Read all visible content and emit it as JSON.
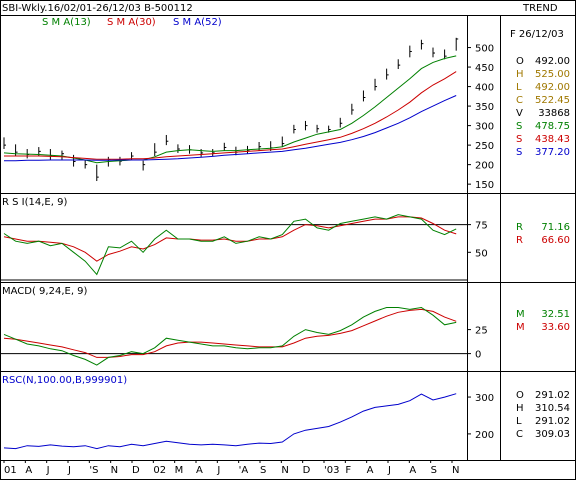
{
  "header": {
    "title": "SBI-Wkly.16/02/01-26/12/03  B-500112",
    "trend_label": "TREND",
    "date_label": "F 26/12/03"
  },
  "colors": {
    "price": "#000000",
    "sma13": "#008000",
    "sma30": "#cc0000",
    "sma52": "#0000cc",
    "rsc": "#0000cc",
    "reference": "#000000"
  },
  "x_axis": {
    "labels": [
      "01",
      "A",
      "J",
      "J",
      "'S",
      "N",
      "D",
      "02",
      "M",
      "A",
      "J",
      "'A",
      "S",
      "N",
      "D",
      "'03",
      "F",
      "A",
      "J",
      "A",
      "S",
      "N"
    ]
  },
  "chart_data": [
    {
      "type": "bar",
      "name": "price",
      "legend": [
        "S M A(13)",
        "S M A(30)",
        "S M A(52)"
      ],
      "yticks": [
        150,
        200,
        250,
        300,
        350,
        400,
        450,
        500
      ],
      "ylim": [
        135,
        545
      ],
      "x": [
        0,
        4,
        8,
        12,
        16,
        20,
        24,
        28,
        32,
        36,
        40,
        44,
        48,
        52,
        56,
        60,
        64,
        68,
        72,
        76,
        80,
        84,
        88,
        92,
        96,
        100,
        104,
        108,
        112,
        116,
        120,
        124,
        128,
        132,
        136,
        140,
        144,
        148,
        152,
        156
      ],
      "close": [
        250,
        232,
        226,
        234,
        222,
        228,
        208,
        200,
        168,
        212,
        209,
        222,
        200,
        232,
        260,
        240,
        238,
        230,
        230,
        244,
        232,
        237,
        246,
        243,
        254,
        290,
        300,
        292,
        290,
        306,
        340,
        372,
        400,
        430,
        455,
        490,
        510,
        486,
        478,
        522
      ],
      "high": [
        270,
        252,
        240,
        245,
        240,
        236,
        225,
        212,
        200,
        220,
        220,
        232,
        210,
        255,
        276,
        252,
        250,
        240,
        240,
        256,
        246,
        248,
        258,
        260,
        272,
        302,
        312,
        302,
        300,
        320,
        356,
        390,
        420,
        446,
        470,
        505,
        520,
        500,
        495,
        525
      ],
      "low": [
        240,
        222,
        216,
        222,
        212,
        212,
        195,
        190,
        158,
        195,
        198,
        212,
        185,
        222,
        250,
        230,
        228,
        220,
        222,
        235,
        224,
        228,
        236,
        235,
        245,
        280,
        288,
        282,
        282,
        295,
        328,
        362,
        390,
        418,
        445,
        475,
        495,
        475,
        470,
        492
      ],
      "series": [
        {
          "name": "S M A(13)",
          "values": [
            230,
            228,
            227,
            226,
            224,
            222,
            217,
            212,
            205,
            208,
            210,
            212,
            212,
            220,
            232,
            236,
            238,
            236,
            234,
            236,
            236,
            238,
            240,
            242,
            246,
            258,
            268,
            278,
            284,
            290,
            306,
            326,
            348,
            372,
            396,
            420,
            446,
            462,
            472,
            478.75
          ]
        },
        {
          "name": "S M A(30)",
          "values": [
            222,
            222,
            222,
            222,
            221,
            220,
            218,
            216,
            214,
            214,
            214,
            215,
            215,
            217,
            220,
            222,
            224,
            226,
            228,
            230,
            232,
            234,
            236,
            238,
            240,
            246,
            252,
            258,
            264,
            270,
            280,
            292,
            306,
            322,
            340,
            360,
            384,
            404,
            420,
            438.43
          ]
        },
        {
          "name": "S M A(52)",
          "values": [
            210,
            210,
            211,
            211,
            212,
            212,
            212,
            212,
            211,
            211,
            212,
            212,
            212,
            213,
            214,
            215,
            217,
            219,
            221,
            224,
            226,
            228,
            230,
            232,
            234,
            238,
            242,
            247,
            252,
            257,
            264,
            272,
            282,
            294,
            306,
            320,
            336,
            350,
            364,
            377.2
          ]
        }
      ],
      "readout": [
        {
          "label": "O",
          "value": "492.00"
        },
        {
          "label": "H",
          "value": "525.00"
        },
        {
          "label": "L",
          "value": "492.00"
        },
        {
          "label": "C",
          "value": "522.45"
        },
        {
          "label": "V",
          "value": "33868"
        },
        {
          "label": "S",
          "value": "478.75"
        },
        {
          "label": "S",
          "value": "438.43"
        },
        {
          "label": "S",
          "value": "377.20"
        }
      ]
    },
    {
      "type": "line",
      "name": "rsi",
      "title": "R S I(14,E, 9)",
      "yticks": [
        50,
        75
      ],
      "ylim": [
        25,
        90
      ],
      "reference_lines": [
        75,
        25
      ],
      "x": [
        0,
        4,
        8,
        12,
        16,
        20,
        24,
        28,
        32,
        36,
        40,
        44,
        48,
        52,
        56,
        60,
        64,
        68,
        72,
        76,
        80,
        84,
        88,
        92,
        96,
        100,
        104,
        108,
        112,
        116,
        120,
        124,
        128,
        132,
        136,
        140,
        144,
        148,
        152,
        156
      ],
      "series": [
        {
          "name": "RSI",
          "values": [
            67,
            60,
            58,
            60,
            56,
            58,
            50,
            42,
            30,
            55,
            54,
            60,
            50,
            62,
            70,
            62,
            62,
            60,
            60,
            64,
            58,
            60,
            64,
            62,
            66,
            78,
            80,
            72,
            70,
            76,
            78,
            80,
            82,
            80,
            84,
            82,
            80,
            70,
            66,
            71.16
          ]
        },
        {
          "name": "Signal",
          "values": [
            64,
            62,
            60,
            60,
            59,
            58,
            55,
            50,
            42,
            48,
            51,
            55,
            53,
            57,
            63,
            62,
            62,
            61,
            61,
            62,
            60,
            60,
            62,
            62,
            64,
            70,
            75,
            74,
            72,
            74,
            76,
            78,
            80,
            80,
            82,
            82,
            81,
            76,
            70,
            66.6
          ]
        }
      ],
      "readout": [
        {
          "label": "R",
          "value": "71.16"
        },
        {
          "label": "R",
          "value": "66.60"
        }
      ]
    },
    {
      "type": "line",
      "name": "macd",
      "title": "MACD( 9,24,E, 9)",
      "yticks": [
        0,
        25
      ],
      "ylim": [
        -15,
        60
      ],
      "reference_lines": [
        0
      ],
      "x": [
        0,
        4,
        8,
        12,
        16,
        20,
        24,
        28,
        32,
        36,
        40,
        44,
        48,
        52,
        56,
        60,
        64,
        68,
        72,
        76,
        80,
        84,
        88,
        92,
        96,
        100,
        104,
        108,
        112,
        116,
        120,
        124,
        128,
        132,
        136,
        140,
        144,
        148,
        152,
        156
      ],
      "series": [
        {
          "name": "MACD",
          "values": [
            20,
            15,
            10,
            8,
            5,
            3,
            -2,
            -6,
            -12,
            -4,
            -2,
            2,
            0,
            6,
            16,
            14,
            12,
            10,
            8,
            8,
            6,
            5,
            6,
            6,
            8,
            18,
            25,
            22,
            20,
            24,
            30,
            38,
            44,
            48,
            48,
            46,
            48,
            40,
            30,
            32.51
          ]
        },
        {
          "name": "Signal",
          "values": [
            16,
            15,
            13,
            11,
            9,
            7,
            4,
            1,
            -4,
            -4,
            -3,
            -1,
            -1,
            2,
            8,
            11,
            12,
            12,
            11,
            10,
            9,
            8,
            7,
            7,
            7,
            11,
            16,
            18,
            19,
            21,
            24,
            29,
            34,
            39,
            43,
            45,
            46,
            44,
            38,
            33.6
          ]
        }
      ],
      "readout": [
        {
          "label": "M",
          "value": "32.51"
        },
        {
          "label": "M",
          "value": "33.60"
        }
      ]
    },
    {
      "type": "line",
      "name": "rsc",
      "title": "RSC(N,100.00,B,999901)",
      "yticks": [
        200,
        300
      ],
      "ylim": [
        140,
        330
      ],
      "x": [
        0,
        4,
        8,
        12,
        16,
        20,
        24,
        28,
        32,
        36,
        40,
        44,
        48,
        52,
        56,
        60,
        64,
        68,
        72,
        76,
        80,
        84,
        88,
        92,
        96,
        100,
        104,
        108,
        112,
        116,
        120,
        124,
        128,
        132,
        136,
        140,
        144,
        148,
        152,
        156
      ],
      "series": [
        {
          "name": "RSC",
          "values": [
            162,
            160,
            168,
            166,
            170,
            167,
            165,
            168,
            160,
            168,
            165,
            172,
            168,
            174,
            180,
            176,
            172,
            170,
            172,
            170,
            168,
            172,
            175,
            174,
            178,
            200,
            210,
            215,
            220,
            232,
            246,
            262,
            272,
            276,
            280,
            290,
            308,
            292,
            300,
            309.03
          ]
        }
      ],
      "readout": [
        {
          "label": "O",
          "value": "291.02"
        },
        {
          "label": "H",
          "value": "310.54"
        },
        {
          "label": "L",
          "value": "291.02"
        },
        {
          "label": "C",
          "value": "309.03"
        }
      ]
    }
  ]
}
